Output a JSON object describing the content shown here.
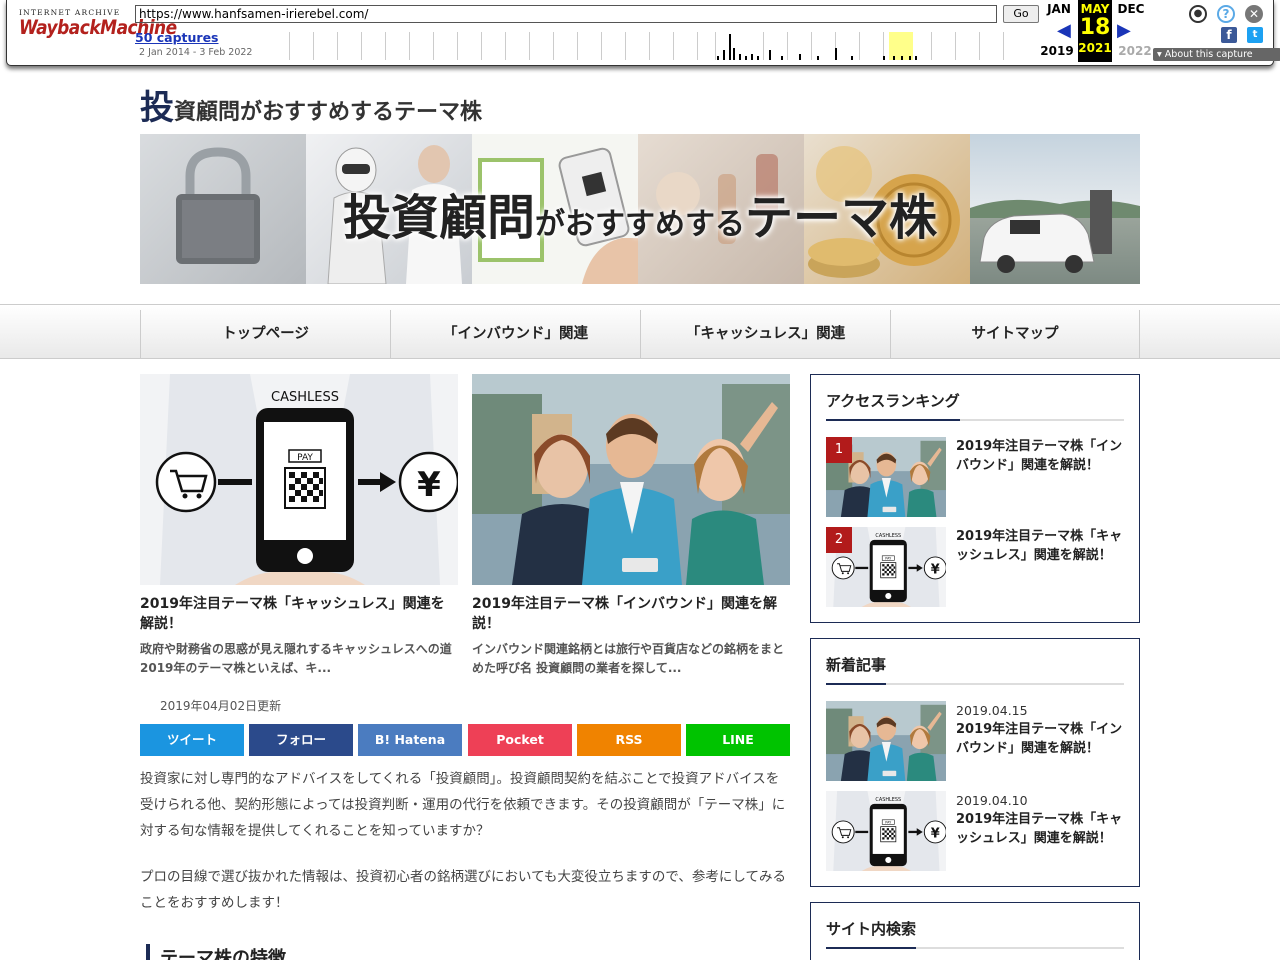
{
  "wayback": {
    "logo_top": "INTERNET ARCHIVE",
    "logo_main": "WaybackMachine",
    "url": "https://www.hanfsamen-irierebel.com/",
    "go_label": "Go",
    "captures_label": "50 captures",
    "date_range": "2 Jan 2014 - 3 Feb 2022",
    "prev_month": "JAN",
    "cur_month": "MAY",
    "next_month": "DEC",
    "cur_day": "18",
    "prev_year": "2019",
    "cur_year": "2021",
    "next_year": "2022",
    "about_label": "About this capture"
  },
  "site": {
    "title_first": "投",
    "title_rest": "資顧問がおすすめするテーマ株",
    "hero_large_1": "投資顧問",
    "hero_small": "がおすすめする",
    "hero_large_2": "テーマ株"
  },
  "nav": [
    {
      "label": "トップページ"
    },
    {
      "label": "「インバウンド」関連"
    },
    {
      "label": "「キャッシュレス」関連"
    },
    {
      "label": "サイトマップ"
    }
  ],
  "cards": [
    {
      "img_text": "CASHLESS",
      "pay_text": "PAY",
      "title": "2019年注目テーマ株「キャッシュレス」関連を解説！",
      "excerpt": "政府や財務省の思惑が見え隠れするキャッシュレスへの道 2019年のテーマ株といえば、キ..."
    },
    {
      "title": "2019年注目テーマ株「インバウンド」関連を解説！",
      "excerpt": "インバウンド関連銘柄とは旅行や百貨店などの銘柄をまとめた呼び名 投資顧問の業者を探して..."
    }
  ],
  "updated": "2019年04月02日更新",
  "share": [
    {
      "label": "ツイート",
      "color": "#1b95e0"
    },
    {
      "label": "フォロー",
      "color": "#2b4a8b"
    },
    {
      "label": "B! Hatena",
      "color": "#4b7cc0"
    },
    {
      "label": "Pocket",
      "color": "#ee4056"
    },
    {
      "label": "RSS",
      "color": "#f08300"
    },
    {
      "label": "LINE",
      "color": "#00c300"
    }
  ],
  "paragraphs": [
    "投資家に対し専門的なアドバイスをしてくれる「投資顧問」。投資顧問契約を結ぶことで投資アドバイスを受けられる他、契約形態によっては投資判断・運用の代行を依頼できます。その投資顧問が「テーマ株」に対する旬な情報を提供してくれることを知っていますか？",
    "プロの目線で選び抜かれた情報は、投資初心者の銘柄選びにおいても大変役立ちますので、参考にしてみることをおすすめします！"
  ],
  "section_heading": "テーマ株の特徴",
  "sidebar": {
    "ranking": {
      "title": "アクセスランキング",
      "items": [
        {
          "rank": "1",
          "title": "2019年注目テーマ株「インバウンド」関連を解説！"
        },
        {
          "rank": "2",
          "title": "2019年注目テーマ株「キャッシュレス」関連を解説！"
        }
      ]
    },
    "latest": {
      "title": "新着記事",
      "items": [
        {
          "date": "2019.04.15",
          "title": "2019年注目テーマ株「インバウンド」関連を解説！"
        },
        {
          "date": "2019.04.10",
          "title": "2019年注目テーマ株「キャッシュレス」関連を解説！"
        }
      ]
    },
    "search": {
      "title": "サイト内検索"
    }
  },
  "colors": {
    "accent": "#1c2b55",
    "rank_badge": "#b21b1b",
    "wayback_link": "#1a35b8",
    "wayback_highlight": "#ffff8a"
  }
}
